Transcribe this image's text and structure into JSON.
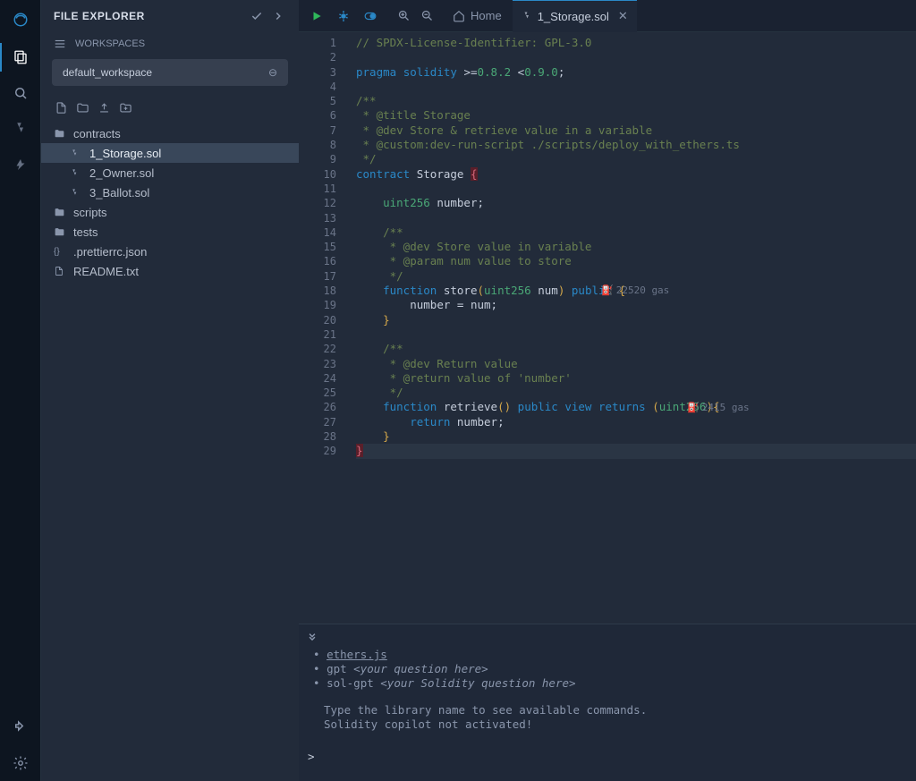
{
  "iconbar": {
    "items": [
      "logo",
      "file-explorer",
      "search",
      "solidity",
      "deploy"
    ],
    "bottom": [
      "plugins",
      "settings"
    ]
  },
  "sidebar": {
    "title": "FILE EXPLORER",
    "workspaces_label": "WORKSPACES",
    "workspace_selected": "default_workspace",
    "tree": [
      {
        "icon": "folder",
        "label": "contracts",
        "depth": 0,
        "sel": false
      },
      {
        "icon": "sol",
        "label": "1_Storage.sol",
        "depth": 1,
        "sel": true
      },
      {
        "icon": "sol",
        "label": "2_Owner.sol",
        "depth": 1,
        "sel": false
      },
      {
        "icon": "sol",
        "label": "3_Ballot.sol",
        "depth": 1,
        "sel": false
      },
      {
        "icon": "folder",
        "label": "scripts",
        "depth": 0,
        "sel": false
      },
      {
        "icon": "folder",
        "label": "tests",
        "depth": 0,
        "sel": false
      },
      {
        "icon": "json",
        "label": ".prettierrc.json",
        "depth": 0,
        "sel": false
      },
      {
        "icon": "doc",
        "label": "README.txt",
        "depth": 0,
        "sel": false
      }
    ]
  },
  "topbar": {
    "home_label": "Home",
    "tab_label": "1_Storage.sol"
  },
  "editor": {
    "lines": 29,
    "gas1": "22520 gas",
    "gas2": "2415 gas",
    "code": [
      {
        "t": "comment",
        "s": "// SPDX-License-Identifier: GPL-3.0"
      },
      {
        "t": "blank",
        "s": ""
      },
      {
        "t": "pragma",
        "s": "pragma solidity >=0.8.2 <0.9.0;"
      },
      {
        "t": "blank",
        "s": ""
      },
      {
        "t": "comment",
        "s": "/**"
      },
      {
        "t": "comment",
        "s": " * @title Storage"
      },
      {
        "t": "comment",
        "s": " * @dev Store & retrieve value in a variable"
      },
      {
        "t": "comment",
        "s": " * @custom:dev-run-script ./scripts/deploy_with_ethers.ts"
      },
      {
        "t": "comment",
        "s": " */"
      },
      {
        "t": "contract",
        "s": "contract Storage {"
      },
      {
        "t": "blank",
        "s": ""
      },
      {
        "t": "decl",
        "s": "    uint256 number;"
      },
      {
        "t": "blank",
        "s": ""
      },
      {
        "t": "comment",
        "s": "    /**"
      },
      {
        "t": "comment",
        "s": "     * @dev Store value in variable"
      },
      {
        "t": "comment",
        "s": "     * @param num value to store"
      },
      {
        "t": "comment",
        "s": "     */"
      },
      {
        "t": "fn1",
        "s": "    function store(uint256 num) public {"
      },
      {
        "t": "body",
        "s": "        number = num;"
      },
      {
        "t": "brace",
        "s": "    }"
      },
      {
        "t": "blank",
        "s": ""
      },
      {
        "t": "comment",
        "s": "    /**"
      },
      {
        "t": "comment",
        "s": "     * @dev Return value"
      },
      {
        "t": "comment",
        "s": "     * @return value of 'number'"
      },
      {
        "t": "comment",
        "s": "     */"
      },
      {
        "t": "fn2",
        "s": "    function retrieve() public view returns (uint256){"
      },
      {
        "t": "ret",
        "s": "        return number;"
      },
      {
        "t": "brace",
        "s": "    }"
      },
      {
        "t": "end",
        "s": "}"
      }
    ]
  },
  "terminal": {
    "bullets": [
      {
        "text": "ethers.js",
        "link": true
      },
      {
        "text": "gpt <your question here>",
        "link": false,
        "italic_from": 4
      },
      {
        "text": "sol-gpt <your Solidity question here>",
        "link": false,
        "italic_from": 8
      }
    ],
    "msg1": "Type the library name to see available commands.",
    "msg2": "Solidity copilot not activated!",
    "prompt": ">"
  }
}
